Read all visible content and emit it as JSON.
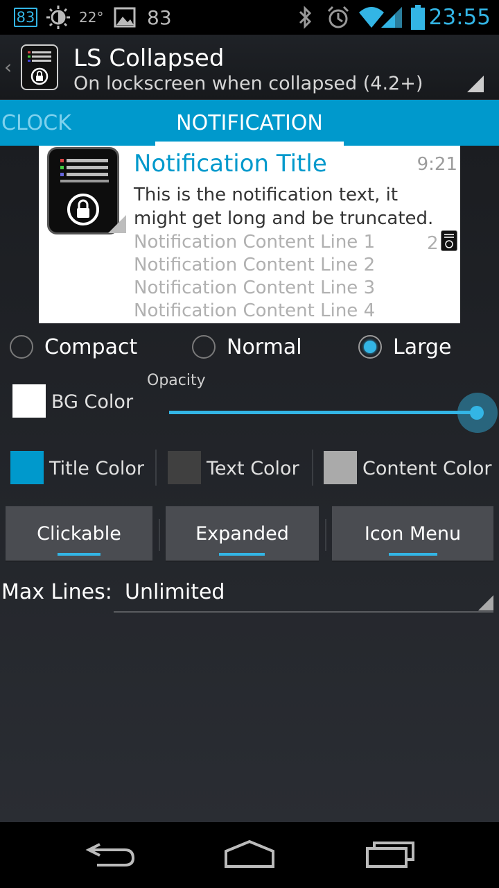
{
  "status_bar": {
    "badge": "83",
    "temperature": "22°",
    "photo_count": "83",
    "time": "23:55"
  },
  "action_bar": {
    "title": "LS Collapsed",
    "subtitle": "On lockscreen when collapsed (4.2+)"
  },
  "tabs": [
    {
      "label": "CLOCK",
      "selected": false
    },
    {
      "label": "NOTIFICATION",
      "selected": true
    }
  ],
  "notification_preview": {
    "title": "Notification Title",
    "time": "9:21",
    "text": "This is the notification text, it might get long and be truncated.",
    "lines": [
      "Notification Content Line 1",
      "Notification Content Line 2",
      "Notification Content Line 3",
      "Notification Content Line 4"
    ],
    "count": "2"
  },
  "size_options": {
    "options": [
      "Compact",
      "Normal",
      "Large"
    ],
    "selected": "Large"
  },
  "bg_color": {
    "label": "BG Color",
    "color": "#ffffff"
  },
  "opacity": {
    "label": "Opacity",
    "value": 1.0
  },
  "colors": [
    {
      "label": "Title Color",
      "color": "#0099cc"
    },
    {
      "label": "Text Color",
      "color": "#404040"
    },
    {
      "label": "Content Color",
      "color": "#aaaaaa"
    }
  ],
  "toggles": [
    {
      "label": "Clickable",
      "on": true
    },
    {
      "label": "Expanded",
      "on": true
    },
    {
      "label": "Icon Menu",
      "on": true
    }
  ],
  "max_lines": {
    "label": "Max Lines:",
    "value": "Unlimited"
  },
  "theme": {
    "accent": "#33b5e5",
    "tab_bar": "#0099cc"
  }
}
